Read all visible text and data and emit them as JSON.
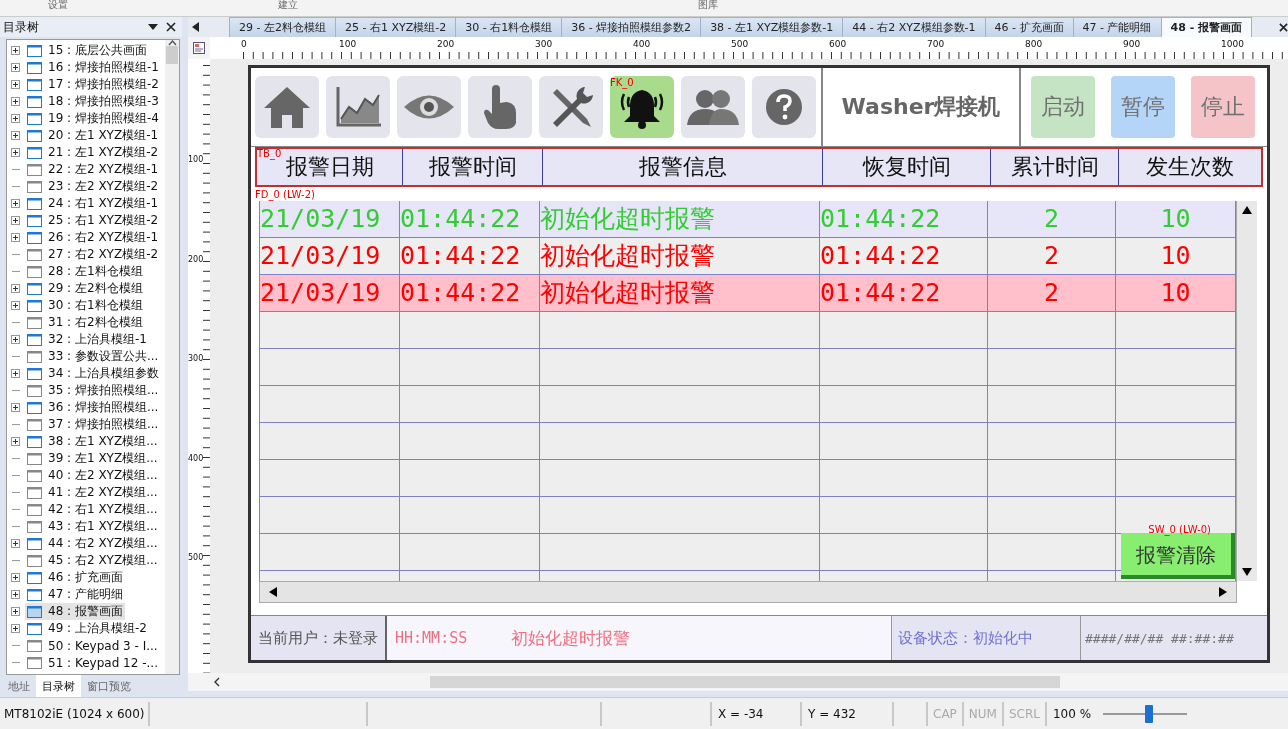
{
  "ribbon": [
    "设置",
    "建立",
    "图库"
  ],
  "tree_panel": {
    "title": "目录树",
    "items": [
      {
        "label": "15 : 底层公共画面",
        "expandable": true,
        "selected": false
      },
      {
        "label": "16 : 焊接拍照模组-1",
        "expandable": true,
        "selected": false
      },
      {
        "label": "17 : 焊接拍照模组-2",
        "expandable": true,
        "selected": false
      },
      {
        "label": "18 : 焊接拍照模组-3",
        "expandable": true,
        "selected": false
      },
      {
        "label": "19 : 焊接拍照模组-4",
        "expandable": true,
        "selected": false
      },
      {
        "label": "20 : 左1 XYZ模组-1",
        "expandable": true,
        "selected": false
      },
      {
        "label": "21 : 左1 XYZ模组-2",
        "expandable": true,
        "selected": false
      },
      {
        "label": "22 : 左2 XYZ模组-1",
        "expandable": false,
        "selected": false
      },
      {
        "label": "23 : 左2 XYZ模组-2",
        "expandable": false,
        "selected": false
      },
      {
        "label": "24 : 右1 XYZ模组-1",
        "expandable": true,
        "selected": false
      },
      {
        "label": "25 : 右1 XYZ模组-2",
        "expandable": true,
        "selected": false
      },
      {
        "label": "26 : 右2 XYZ模组-1",
        "expandable": true,
        "selected": false
      },
      {
        "label": "27 : 右2 XYZ模组-2",
        "expandable": false,
        "selected": false
      },
      {
        "label": "28 : 左1料仓模组",
        "expandable": false,
        "selected": false
      },
      {
        "label": "29 : 左2料仓模组",
        "expandable": true,
        "selected": false
      },
      {
        "label": "30 : 右1料仓模组",
        "expandable": true,
        "selected": false
      },
      {
        "label": "31 : 右2料仓模组",
        "expandable": false,
        "selected": false
      },
      {
        "label": "32 : 上治具模组-1",
        "expandable": true,
        "selected": false
      },
      {
        "label": "33 : 参数设置公共...",
        "expandable": false,
        "selected": false
      },
      {
        "label": "34 : 上治具模组参数",
        "expandable": true,
        "selected": false
      },
      {
        "label": "35 : 焊接拍照模组...",
        "expandable": false,
        "selected": false
      },
      {
        "label": "36 : 焊接拍照模组...",
        "expandable": true,
        "selected": false
      },
      {
        "label": "37 : 焊接拍照模组...",
        "expandable": false,
        "selected": false
      },
      {
        "label": "38 : 左1 XYZ模组...",
        "expandable": true,
        "selected": false
      },
      {
        "label": "39 : 左1 XYZ模组...",
        "expandable": false,
        "selected": false
      },
      {
        "label": "40 : 左2 XYZ模组...",
        "expandable": false,
        "selected": false
      },
      {
        "label": "41 : 左2 XYZ模组...",
        "expandable": false,
        "selected": false
      },
      {
        "label": "42 : 右1 XYZ模组...",
        "expandable": false,
        "selected": false
      },
      {
        "label": "43 : 右1 XYZ模组...",
        "expandable": false,
        "selected": false
      },
      {
        "label": "44 : 右2 XYZ模组...",
        "expandable": true,
        "selected": false
      },
      {
        "label": "45 : 右2 XYZ模组...",
        "expandable": false,
        "selected": false
      },
      {
        "label": "46 : 扩充画面",
        "expandable": true,
        "selected": false
      },
      {
        "label": "47 : 产能明细",
        "expandable": true,
        "selected": false
      },
      {
        "label": "48 : 报警画面",
        "expandable": true,
        "selected": true
      },
      {
        "label": "49 : 上治具模组-2",
        "expandable": true,
        "selected": false
      },
      {
        "label": "50 : Keypad 3 - I...",
        "expandable": false,
        "selected": false
      },
      {
        "label": "51 : Keypad 12 -...",
        "expandable": false,
        "selected": false
      }
    ],
    "tabs": [
      {
        "label": "地址",
        "selected": false
      },
      {
        "label": "目录树",
        "selected": true
      },
      {
        "label": "窗口预览",
        "selected": false
      }
    ]
  },
  "doc_tabs": [
    {
      "label": "29 - 左2料仓模组",
      "selected": false
    },
    {
      "label": "25 - 右1 XYZ模组-2",
      "selected": false
    },
    {
      "label": "30 - 右1料仓模组",
      "selected": false
    },
    {
      "label": "36 - 焊接拍照模组参数2",
      "selected": false
    },
    {
      "label": "38 - 左1 XYZ模组参数-1",
      "selected": false
    },
    {
      "label": "44 - 右2 XYZ模组参数-1",
      "selected": false
    },
    {
      "label": "46 - 扩充画面",
      "selected": false
    },
    {
      "label": "47 - 产能明细",
      "selected": false
    },
    {
      "label": "48 - 报警画面",
      "selected": true
    }
  ],
  "ruler": {
    "horizontal": [
      "0",
      "100",
      "200",
      "300",
      "400",
      "500",
      "600",
      "700",
      "800",
      "900",
      "1000"
    ],
    "vertical": [
      "100",
      "200",
      "300",
      "400",
      "500"
    ]
  },
  "hmi": {
    "nav_buttons": [
      {
        "selected": false
      },
      {
        "selected": false
      },
      {
        "selected": false
      },
      {
        "selected": false
      },
      {
        "selected": false
      },
      {
        "selected": true,
        "tag": "FK_0"
      },
      {
        "selected": false
      },
      {
        "selected": false
      }
    ],
    "title": "Washer焊接机",
    "controls": [
      {
        "label": "启动",
        "color": "#c4e4c4"
      },
      {
        "label": "暂停",
        "color": "#b4d4f8"
      },
      {
        "label": "停止",
        "color": "#f4c4c8"
      }
    ],
    "table": {
      "header_tag": "TB_0",
      "tag": "FD_0 (LW-2)",
      "columns": [
        "报警日期",
        "报警时间",
        "报警信息",
        "恢复时间",
        "累计时间",
        "发生次数"
      ],
      "rows": [
        {
          "kind": "recovered",
          "color": "#33cc33",
          "selected": false,
          "cells": [
            "21/03/19",
            "01:44:22",
            "初始化超时报警",
            "01:44:22",
            "2",
            "10"
          ]
        },
        {
          "kind": "active",
          "color": "#ff0000",
          "selected": false,
          "cells": [
            "21/03/19",
            "01:44:22",
            "初始化超时报警",
            "01:44:22",
            "2",
            "10"
          ]
        },
        {
          "kind": "active",
          "color": "#ff0000",
          "selected": true,
          "cells": [
            "21/03/19",
            "01:44:22",
            "初始化超时报警",
            "01:44:22",
            "2",
            "10"
          ]
        }
      ]
    },
    "clear_button": {
      "label": "报警清除",
      "tag": "SW_0 (LW-0)"
    },
    "footer": {
      "user": "当前用户：未登录",
      "time": "HH:MM:SS",
      "message": "初始化超时报警",
      "status": "设备状态：初始化中",
      "datetime": "####/##/## ##:##:##"
    }
  },
  "status_bar": {
    "model": "MT8102iE (1024 x 600)",
    "x": "X = -34",
    "y": "Y = 432",
    "keys": [
      {
        "label": "CAP",
        "on": false
      },
      {
        "label": "NUM",
        "on": false
      },
      {
        "label": "SCRL",
        "on": false
      }
    ],
    "zoom": "100 %",
    "zoom_slider": {
      "level": 0.55
    }
  }
}
